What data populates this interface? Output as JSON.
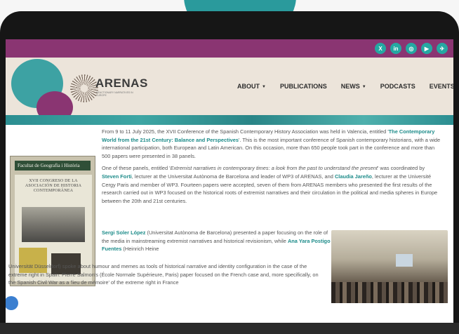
{
  "header": {
    "logo_text": "ARENAS",
    "logo_tag": "REACTIONARY NARRATIVES IN EUROPE"
  },
  "social": [
    {
      "icon": "x-icon",
      "glyph": "X"
    },
    {
      "icon": "linkedin-icon",
      "glyph": "in"
    },
    {
      "icon": "instagram-icon",
      "glyph": "◎"
    },
    {
      "icon": "youtube-icon",
      "glyph": "▶"
    },
    {
      "icon": "bluesky-icon",
      "glyph": "✈"
    }
  ],
  "nav": {
    "about": "ABOUT",
    "publications": "PUBLICATIONS",
    "news": "NEWS",
    "podcasts": "PODCASTS",
    "events": "EVENTS"
  },
  "poster": {
    "header": "Facultat de Geografia i Història",
    "title": "XVII CONGRESO DE LA ASOCIACIÓN DE HISTORIA CONTEMPORÁNEA"
  },
  "article": {
    "p1_before": "From 9 to 11 July 2025, the XVII Conference of the Spanish Contemporary History Association was held in Valencia, entitled '",
    "p1_link": "The Contemporary World from the 21st Century: Balance and Perspectives",
    "p1_after": "'. This is the most important conference of Spanish contemporary historians, with a wide international participation, both European and Latin American. On this occasion, more than 650 people took part in the conference and more than 500 papers were presented in 38 panels.",
    "p2_before": "One of these panels, entitled '",
    "p2_italic": "Extremist narratives in contemporary times: a look from the past to understand the present",
    "p2_mid": "' was coordinated by ",
    "p2_name1": "Steven Forti",
    "p2_mid2": ", lecturer at the Universitat Autònoma de Barcelona and leader of WP3 of ARENAS, and ",
    "p2_name2": "Claudia Jareño",
    "p2_after": ", lecturer at the Université Cergy Paris and member of WP3. Fourteen papers were accepted, seven of them from ARENAS members who presented the first results of the research carried out in WP3 focused on the historical roots of extremist narratives and their circulation in the political and media spheres in Europe between the 20th and 21st centuries.",
    "p3_name1": "Sergi Soler López",
    "p3_a": " (Universitat Autònoma de Barcelona) presented a paper focusing on the role of the media in mainstreaming extremist narratives and historical revisionism, while ",
    "p3_name2": "Ana Yara Postigo Fuentes",
    "p3_b": " (Heinrich Heine",
    "p3_full": "Universität Düsseldorf) spoke about humour and memes as tools of historical narrative and identity configuration in the case of the extreme right in Spain. Pierre Salmon's (École Normale Supérieure, Paris) paper focused on the French case and, more specifically, on the Spanish Civil War as a 'lieu de mémoire' of the extreme right in France"
  }
}
